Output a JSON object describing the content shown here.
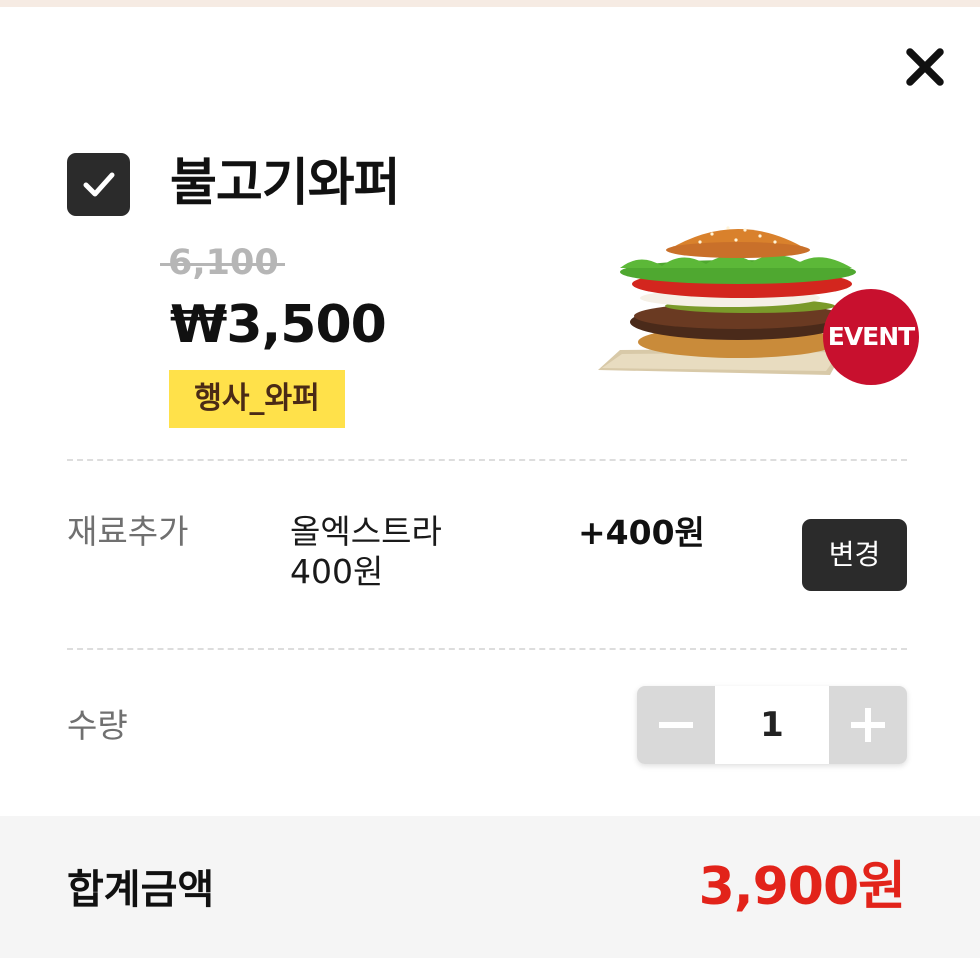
{
  "product": {
    "name": "불고기와퍼",
    "original_price": "6,100",
    "sale_price": "₩3,500",
    "promo_tag": "행사_와퍼",
    "event_badge": "EVENT",
    "selected": true
  },
  "options": {
    "label": "재료추가",
    "value_line1": "올엑스트라",
    "value_line2": "400원",
    "price": "+400원",
    "change_button": "변경"
  },
  "quantity": {
    "label": "수량",
    "value": "1"
  },
  "total": {
    "label": "합계금액",
    "value": "3,900원"
  },
  "colors": {
    "accent_red": "#e2231a",
    "dark_button": "#2b2b2b",
    "promo_yellow": "#ffe14a",
    "event_red": "#c8102e"
  },
  "icons": [
    "close-icon",
    "checkmark-icon",
    "minus-icon",
    "plus-icon"
  ]
}
